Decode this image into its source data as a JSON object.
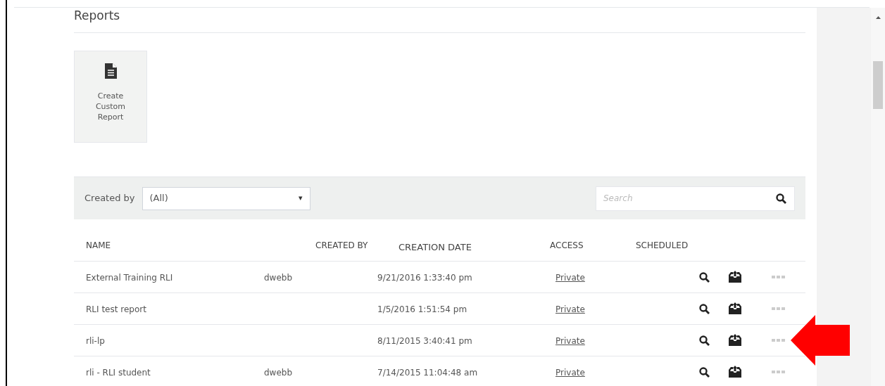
{
  "page_title": "Reports",
  "create_tile": {
    "label": "Create Custom Report"
  },
  "filter": {
    "label": "Created by",
    "value": "(All)",
    "caret": "▾"
  },
  "search": {
    "placeholder": "Search"
  },
  "table": {
    "columns": [
      "NAME",
      "CREATED BY",
      "CREATION DATE",
      "ACCESS",
      "SCHEDULED"
    ],
    "rows": [
      {
        "name": "External Training RLI",
        "created_by": "dwebb",
        "creation_date": "9/21/2016 1:33:40 pm",
        "access": "Private"
      },
      {
        "name": "RLI test report",
        "creation_date": "1/5/2016 1:51:54 pm",
        "access": "Private"
      },
      {
        "name": "rli-lp",
        "creation_date": "8/11/2015 3:40:41 pm",
        "access": "Private"
      },
      {
        "name": "rli - RLI student",
        "created_by": "dwebb",
        "creation_date": "7/14/2015 11:04:48 am",
        "access": "Private"
      }
    ]
  }
}
